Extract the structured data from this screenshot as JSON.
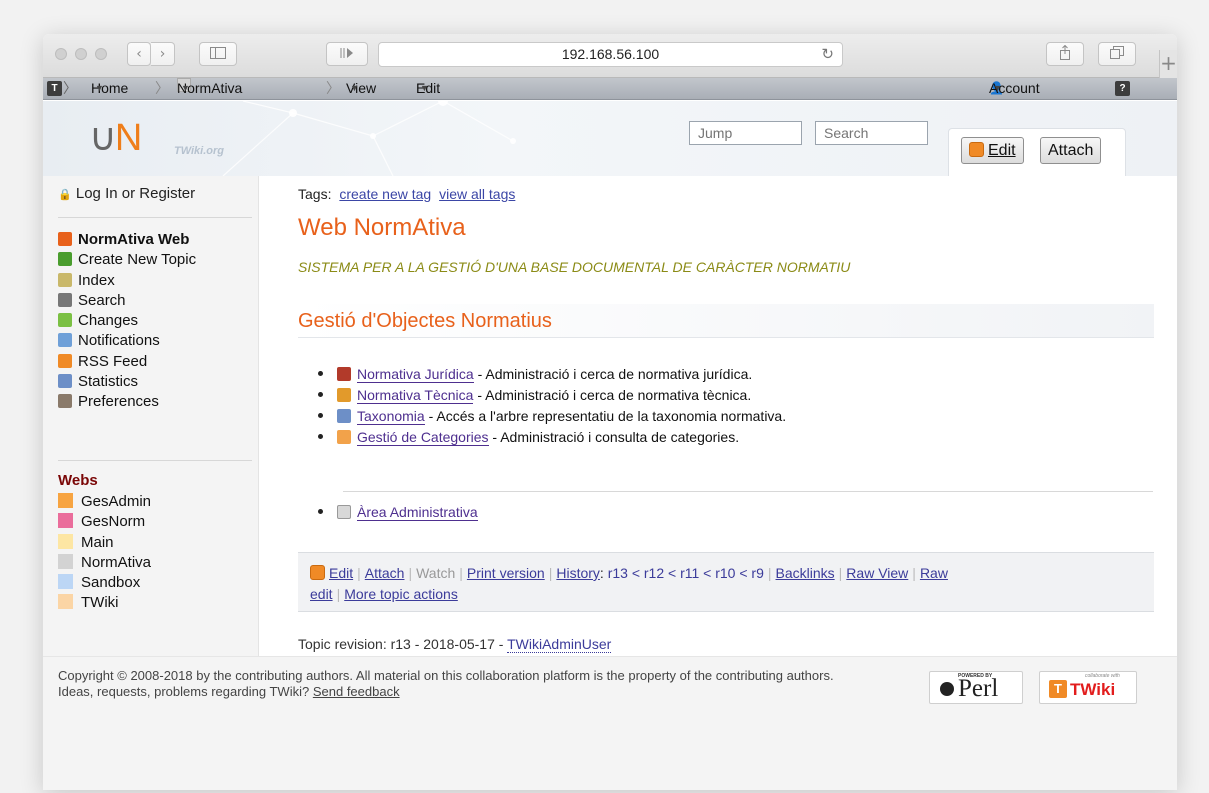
{
  "browser": {
    "url": "192.168.56.100",
    "nav_back": "‹",
    "nav_forward": "›"
  },
  "twiki_bar": {
    "home": "Home",
    "web": "NormAtiva Web",
    "view": "View",
    "edit": "Edit",
    "account": "Account"
  },
  "header": {
    "logo_text": "N",
    "logo_sub": "TWiki.org",
    "jump_placeholder": "Jump",
    "search_placeholder": "Search",
    "edit_button": "Edit",
    "attach_button": "Attach"
  },
  "sidebar": {
    "login": "Log In",
    "or": "or",
    "register": "Register",
    "items": [
      {
        "label": "NormAtiva Web",
        "icon": "home-icon",
        "color": "#e8611b"
      },
      {
        "label": "Create New Topic",
        "icon": "new-topic-icon",
        "color": "#4a9d2e"
      },
      {
        "label": "Index",
        "icon": "index-icon",
        "color": "#c9b86a"
      },
      {
        "label": "Search",
        "icon": "search-icon",
        "color": "#777777"
      },
      {
        "label": "Changes",
        "icon": "changes-icon",
        "color": "#7bc043"
      },
      {
        "label": "Notifications",
        "icon": "notify-icon",
        "color": "#6fa0d8"
      },
      {
        "label": "RSS Feed",
        "icon": "rss-icon",
        "color": "#f08a26"
      },
      {
        "label": "Statistics",
        "icon": "statistics-icon",
        "color": "#6d8fc7"
      },
      {
        "label": "Preferences",
        "icon": "preferences-icon",
        "color": "#8a7a6a"
      }
    ],
    "webs_title": "Webs",
    "webs": [
      {
        "label": "GesAdmin",
        "color": "#f7a441"
      },
      {
        "label": "GesNorm",
        "color": "#ea6d9b"
      },
      {
        "label": "Main",
        "color": "#fde6a3"
      },
      {
        "label": "NormAtiva",
        "color": "#d3d3d3"
      },
      {
        "label": "Sandbox",
        "color": "#bcd6f5"
      },
      {
        "label": "TWiki",
        "color": "#fbd5a5"
      }
    ]
  },
  "main": {
    "tags_label": "Tags:",
    "tags_create": "create new tag",
    "tags_view": "view all tags",
    "title": "Web NormAtiva",
    "subtitle": "SISTEMA PER A LA GESTIÓ D'UNA BASE DOCUMENTAL DE CARÀCTER NORMATIU",
    "section_title": "Gestió d'Objectes Normatius",
    "items": [
      {
        "link": "Normativa Jurídica",
        "desc": " - Administració i cerca de normativa jurídica.",
        "icon": "gavel-icon",
        "color": "#b23a2a"
      },
      {
        "link": "Normativa Tècnica",
        "desc": " - Administració i cerca de normativa tècnica.",
        "icon": "gears-icon",
        "color": "#e29a2b"
      },
      {
        "link": "Taxonomia",
        "desc": " - Accés a l'arbre representatiu de la taxonomia normativa.",
        "icon": "tree-icon",
        "color": "#6d8fc7"
      },
      {
        "link": "Gestió de Categories",
        "desc": " - Administració i consulta de categories.",
        "icon": "tag-icon",
        "color": "#f2a24a"
      }
    ],
    "admin_link": "Àrea Administrativa",
    "actions": {
      "edit": "Edit",
      "attach": "Attach",
      "watch": "Watch",
      "print": "Print version",
      "history": "History",
      "history_revs": "r13 < r12 < r11 < r10 < r9",
      "backlinks": "Backlinks",
      "raw_view": "Raw View",
      "raw_edit_1": "Raw",
      "raw_edit_2": "edit",
      "more": "More topic actions"
    },
    "revision_text": "Topic revision: r13 - 2018-05-17 - ",
    "revision_user": "TWikiAdminUser"
  },
  "footer": {
    "copyright": "Copyright © 2008-2018 by the contributing authors. All material on this collaboration platform is the property of the contributing authors.",
    "ideas": "Ideas, requests, problems regarding TWiki?",
    "feedback": "Send feedback",
    "perl_small": "POWERED BY",
    "perl": "Perl",
    "twiki_small": "collaborate with",
    "twiki": "TWiki"
  }
}
